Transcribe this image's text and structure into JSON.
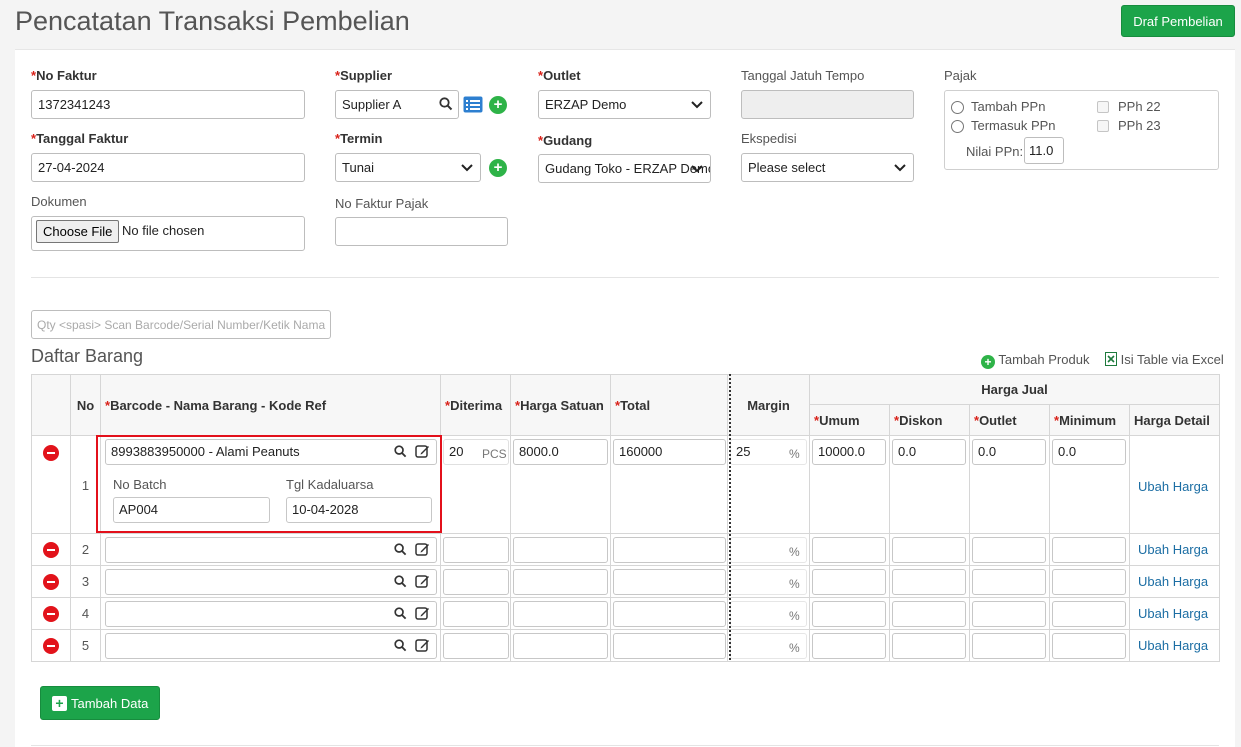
{
  "header": {
    "title": "Pencatatan Transaksi Pembelian",
    "draf_button": "Draf Pembelian"
  },
  "form": {
    "no_faktur": {
      "label": "No Faktur",
      "value": "1372341243"
    },
    "tanggal_faktur": {
      "label": "Tanggal Faktur",
      "value": "27-04-2024"
    },
    "dokumen": {
      "label": "Dokumen",
      "button": "Choose File",
      "status": "No file chosen"
    },
    "supplier": {
      "label": "Supplier",
      "value": "Supplier A"
    },
    "termin": {
      "label": "Termin",
      "value": "Tunai"
    },
    "no_faktur_pajak": {
      "label": "No Faktur Pajak",
      "value": ""
    },
    "outlet": {
      "label": "Outlet",
      "value": "ERZAP Demo"
    },
    "gudang": {
      "label": "Gudang",
      "value": "Gudang Toko - ERZAP Demo"
    },
    "tanggal_jatuh_tempo": {
      "label": "Tanggal Jatuh Tempo",
      "value": ""
    },
    "ekspedisi": {
      "label": "Ekspedisi",
      "value": "Please select"
    },
    "pajak": {
      "label": "Pajak",
      "tambah_ppn": "Tambah PPn",
      "termasuk_ppn": "Termasuk PPn",
      "pph22": "PPh 22",
      "pph23": "PPh 23",
      "nilai_ppn_label": "Nilai PPn:",
      "nilai_ppn": "11.0"
    }
  },
  "scan": {
    "placeholder": "Qty <spasi> Scan Barcode/Serial Number/Ketik Nama"
  },
  "daftar": {
    "title": "Daftar Barang",
    "tambah_produk": "Tambah Produk",
    "isi_excel": "Isi Table via Excel",
    "tambah_data": "Tambah Data"
  },
  "table": {
    "headers": {
      "no": "No",
      "barcode": "Barcode - Nama Barang - Kode Ref",
      "diterima": "Diterima",
      "harga_satuan": "Harga Satuan",
      "total": "Total",
      "margin": "Margin",
      "harga_jual": "Harga Jual",
      "umum": "Umum",
      "diskon": "Diskon",
      "outlet": "Outlet",
      "minimum": "Minimum",
      "harga_detail": "Harga Detail"
    },
    "first_row": {
      "no": "1",
      "barcode": "8993883950000 - Alami Peanuts",
      "batch_label": "No Batch",
      "batch": "AP004",
      "exp_label": "Tgl Kadaluarsa",
      "exp": "10-04-2028",
      "diterima": "20",
      "unit": "PCS",
      "harga_satuan": "8000.0",
      "total": "160000",
      "margin": "25",
      "pct": "%",
      "umum": "10000.0",
      "diskon": "0.0",
      "outlet": "0.0",
      "minimum": "0.0",
      "ubah": "Ubah Harga"
    },
    "rows": [
      {
        "no": "2",
        "pct": "%",
        "ubah": "Ubah Harga"
      },
      {
        "no": "3",
        "pct": "%",
        "ubah": "Ubah Harga"
      },
      {
        "no": "4",
        "pct": "%",
        "ubah": "Ubah Harga"
      },
      {
        "no": "5",
        "pct": "%",
        "ubah": "Ubah Harga"
      }
    ]
  },
  "colors": {
    "green": "#1ca44a",
    "red": "#e2131b",
    "link": "#1c6ea4"
  }
}
